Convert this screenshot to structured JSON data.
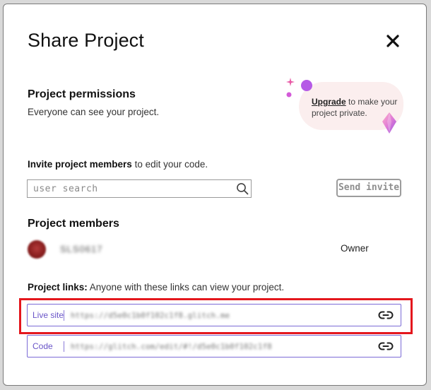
{
  "dialog": {
    "title": "Share Project",
    "close_icon": "close-icon"
  },
  "permissions": {
    "title": "Project permissions",
    "subtitle": "Everyone can see your project.",
    "upgrade_link": "Upgrade",
    "upgrade_text": " to make your project private.",
    "decoration_icons": [
      "sparkle-icon",
      "gem-icon"
    ]
  },
  "invite": {
    "label_bold": "Invite project members",
    "label_rest": " to edit your code.",
    "search_placeholder": "user search",
    "search_value": "",
    "search_icon": "search-icon",
    "send_label": "Send invite"
  },
  "members": {
    "title": "Project members",
    "list": [
      {
        "name": "SLS0617",
        "role": "Owner"
      }
    ]
  },
  "links": {
    "label_bold": "Project links:",
    "label_rest": " Anyone with these links can view your project.",
    "items": [
      {
        "tag": "Live site",
        "url": "https://d5e0c1b0f102c1f8.glitch.me",
        "icon": "link-icon"
      },
      {
        "tag": "Code",
        "url": "https://glitch.com/edit/#!/d5e0c1b0f102c1f8",
        "icon": "link-icon"
      }
    ]
  },
  "colors": {
    "accent_purple": "#7b6ad6",
    "highlight_red": "#e4171d",
    "upgrade_blob": "#fbeeee"
  }
}
